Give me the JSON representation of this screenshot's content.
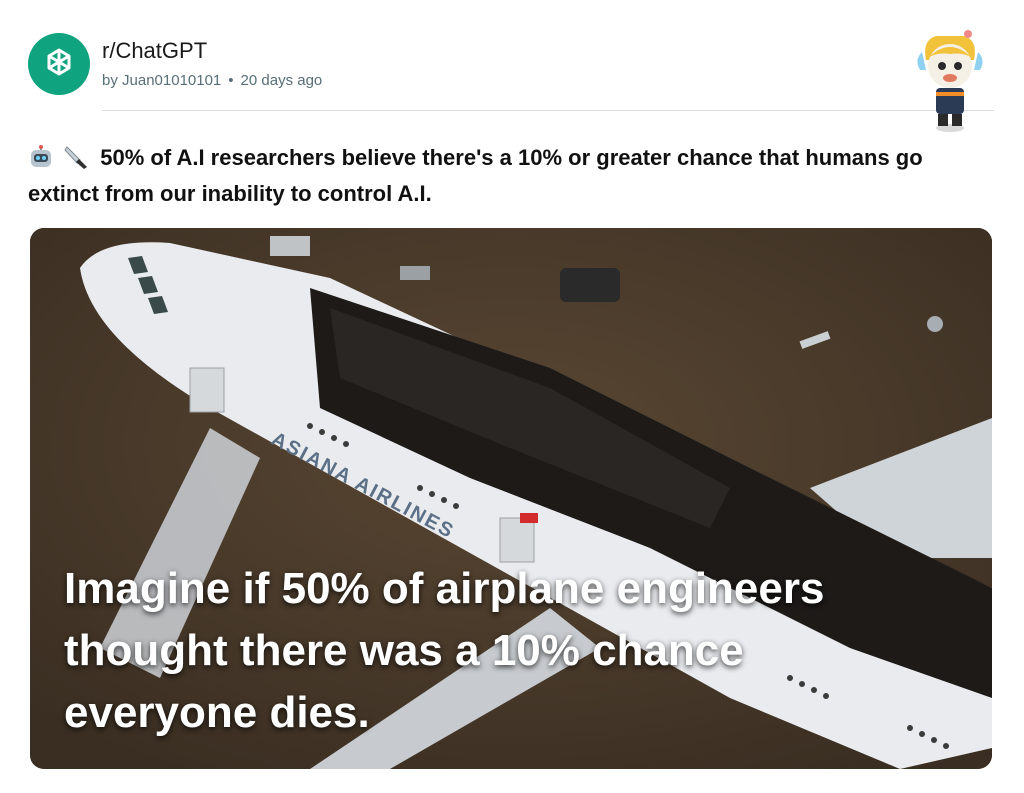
{
  "post": {
    "subreddit": "r/ChatGPT",
    "author": "by Juan01010101",
    "separator": "•",
    "time": "20 days ago",
    "title": "50% of A.I researchers believe there's a 10% or greater chance that humans go extinct from our inability to control A.I.",
    "title_emojis": [
      "robot-face-icon",
      "knife-icon"
    ],
    "image": {
      "caption": "Imagine if 50% of airplane engineers thought there was a 10% chance everyone dies.",
      "fuselage_text": "ASIANA AIRLINES"
    }
  },
  "colors": {
    "subreddit_avatar": "#10a37f",
    "ground": "#4a3a2b",
    "fuselage": "#e9ebee",
    "burnt": "#1d1a18"
  }
}
